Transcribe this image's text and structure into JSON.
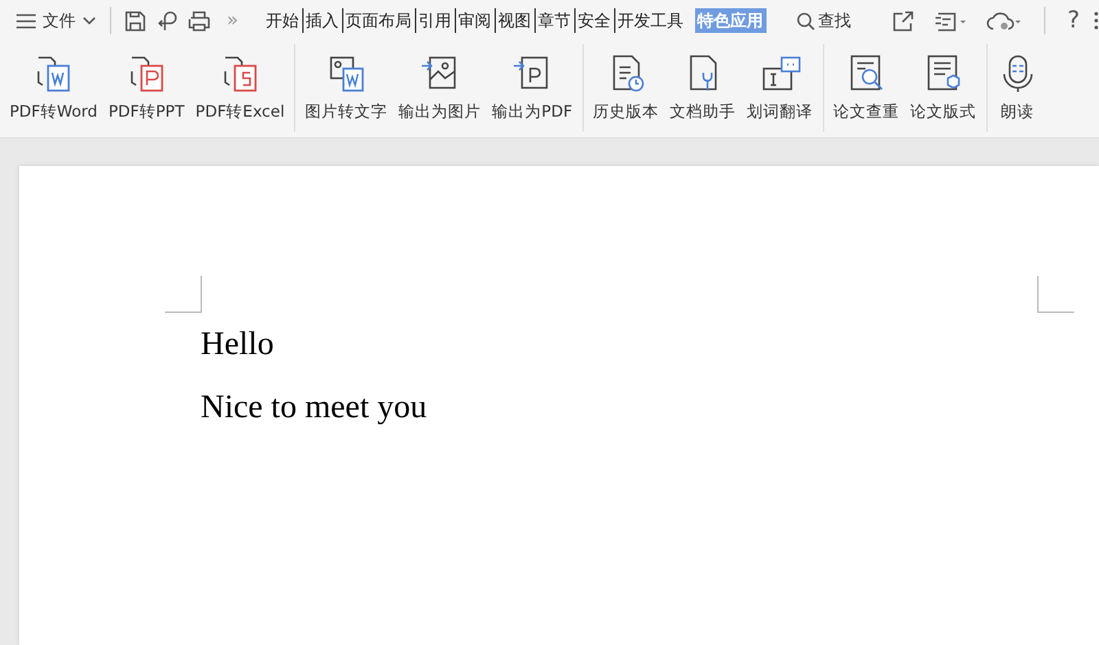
{
  "menu": {
    "label": "文件"
  },
  "quick_access": {
    "more": "»"
  },
  "tabs": [
    {
      "label": "开始",
      "selected": false
    },
    {
      "label": "插入",
      "selected": false
    },
    {
      "label": "页面布局",
      "selected": false
    },
    {
      "label": "引用",
      "selected": false
    },
    {
      "label": "审阅",
      "selected": false
    },
    {
      "label": "视图",
      "selected": false
    },
    {
      "label": "章节",
      "selected": false
    },
    {
      "label": "安全",
      "selected": false
    },
    {
      "label": "开发工具",
      "selected": false
    },
    {
      "label": "特色应用",
      "selected": true
    }
  ],
  "search": {
    "label": "查找"
  },
  "help": {
    "label": "?"
  },
  "ribbon": {
    "groups": [
      {
        "buttons": [
          {
            "label": "PDF转Word",
            "kind": "pdf-word"
          },
          {
            "label": "PDF转PPT",
            "kind": "pdf-ppt"
          },
          {
            "label": "PDF转Excel",
            "kind": "pdf-excel"
          }
        ]
      },
      {
        "buttons": [
          {
            "label": "图片转文字",
            "kind": "image-text"
          },
          {
            "label": "输出为图片",
            "kind": "export-image"
          },
          {
            "label": "输出为PDF",
            "kind": "export-pdf"
          }
        ]
      },
      {
        "buttons": [
          {
            "label": "历史版本",
            "kind": "history"
          },
          {
            "label": "文档助手",
            "kind": "assistant"
          },
          {
            "label": "划词翻译",
            "kind": "translate"
          }
        ]
      },
      {
        "buttons": [
          {
            "label": "论文查重",
            "kind": "check"
          },
          {
            "label": "论文版式",
            "kind": "format"
          }
        ]
      },
      {
        "buttons": [
          {
            "label": "朗读",
            "kind": "read"
          }
        ]
      }
    ]
  },
  "document": {
    "paragraphs": [
      "Hello",
      "Nice to meet you"
    ]
  }
}
